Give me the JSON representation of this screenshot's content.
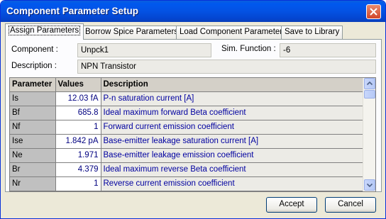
{
  "window": {
    "title": "Component Parameter Setup"
  },
  "tabs": [
    {
      "label": "Assign Parameters",
      "active": true
    },
    {
      "label": "Borrow Spice Parameters",
      "active": false
    },
    {
      "label": "Load Component Parameters",
      "active": false
    },
    {
      "label": "Save to Library",
      "active": false
    }
  ],
  "component": {
    "label": "Component :",
    "value": "Unpck1"
  },
  "sim_function": {
    "label": "Sim. Function :",
    "value": "-6"
  },
  "description": {
    "label": "Description :",
    "value": "NPN Transistor"
  },
  "grid": {
    "headers": {
      "parameter": "Parameter",
      "values": "Values",
      "description": "Description"
    },
    "rows": [
      {
        "param": "Is",
        "value": "12.03 fA",
        "desc": "P-n saturation current [A]"
      },
      {
        "param": "Bf",
        "value": "685.8",
        "desc": "Ideal maximum forward Beta coefficient"
      },
      {
        "param": "Nf",
        "value": "1",
        "desc": "Forward current emission coefficient"
      },
      {
        "param": "Ise",
        "value": "1.842 pA",
        "desc": "Base-emitter leakage saturation current [A]"
      },
      {
        "param": "Ne",
        "value": "1.971",
        "desc": "Base-emitter leakage emission coefficient"
      },
      {
        "param": "Br",
        "value": "4.379",
        "desc": "Ideal maximum reverse Beta coefficient"
      },
      {
        "param": "Nr",
        "value": "1",
        "desc": "Reverse current emission coefficient"
      }
    ]
  },
  "buttons": {
    "accept": "Accept",
    "cancel": "Cancel"
  },
  "icons": {
    "close": "close-icon",
    "scroll_up": "arrow-up-icon",
    "scroll_down": "arrow-down-icon"
  },
  "colors": {
    "title_bar": "#0452e3",
    "close_button": "#d2462a",
    "description_text": "#0000a0"
  }
}
